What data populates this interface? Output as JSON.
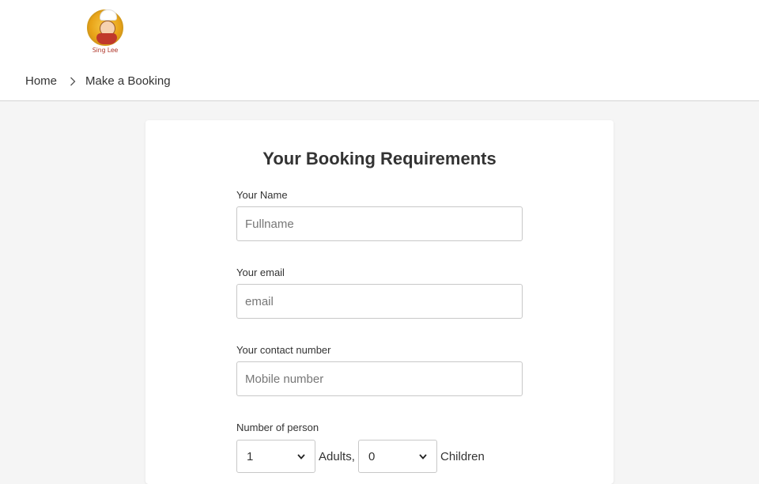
{
  "header": {
    "logo_text": "Sing Lee"
  },
  "breadcrumb": {
    "home": "Home",
    "current": "Make a Booking"
  },
  "form": {
    "title": "Your Booking Requirements",
    "name": {
      "label": "Your Name",
      "placeholder": "Fullname"
    },
    "email": {
      "label": "Your email",
      "placeholder": "email"
    },
    "contact": {
      "label": "Your contact number",
      "placeholder": "Mobile number"
    },
    "persons": {
      "label": "Number of person",
      "adults_value": "1",
      "adults_suffix": "Adults,",
      "children_value": "0",
      "children_suffix": "Children"
    }
  },
  "colors": {
    "page_bg": "#f5f5f5",
    "card_bg": "#ffffff",
    "text": "#333333",
    "border": "#c8c8c8"
  }
}
